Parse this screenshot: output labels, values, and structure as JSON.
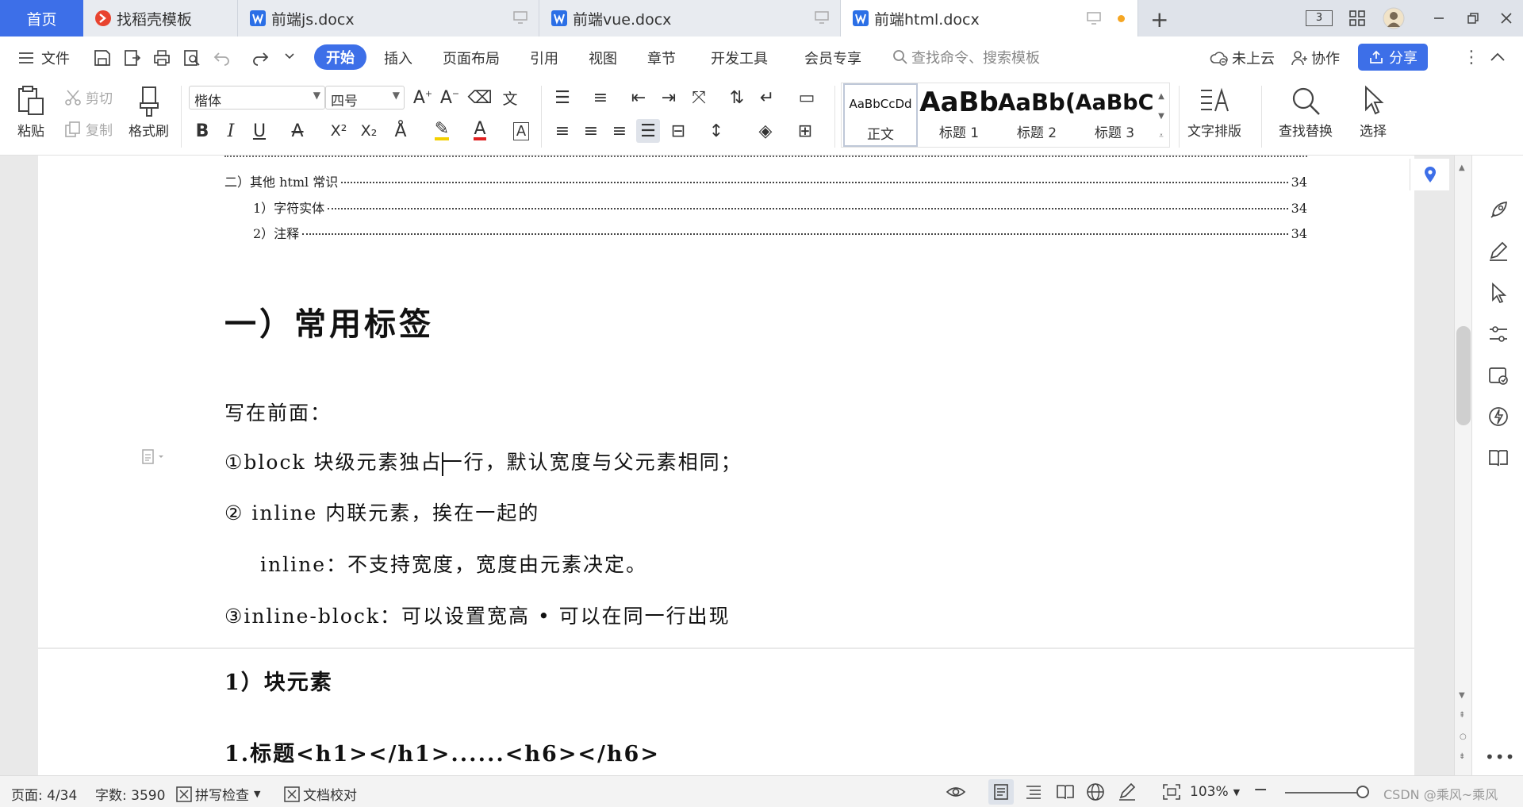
{
  "tabs": {
    "home": "首页",
    "items": [
      {
        "label": "找稻壳模板"
      },
      {
        "label": "前端js.docx"
      },
      {
        "label": "前端vue.docx"
      },
      {
        "label": "前端html.docx"
      }
    ],
    "layout_label": "3"
  },
  "menu": {
    "file": "文件",
    "items": [
      "开始",
      "插入",
      "页面布局",
      "引用",
      "视图",
      "章节",
      "开发工具",
      "会员专享"
    ],
    "search_placeholder": "查找命令、搜索模板",
    "cloud": "未上云",
    "collab": "协作",
    "share": "分享"
  },
  "ribbon": {
    "paste": "粘贴",
    "cut": "剪切",
    "copy": "复制",
    "format_painter": "格式刷",
    "font_name": "楷体",
    "font_size": "四号",
    "styles": [
      {
        "sample": "AaBbCcDd",
        "name": "正文"
      },
      {
        "sample": "AaBb",
        "name": "标题 1"
      },
      {
        "sample": "AaBb(",
        "name": "标题 2"
      },
      {
        "sample": "AaBbC",
        "name": "标题 3"
      }
    ],
    "text_layout": "文字排版",
    "find_replace": "查找替换",
    "select": "选择"
  },
  "document": {
    "toc": [
      {
        "text": "二）其他 html 常识",
        "page": "34"
      },
      {
        "text": "1）字符实体",
        "page": "34"
      },
      {
        "text": "2）注释",
        "page": "34"
      }
    ],
    "heading1": "一）常用标签",
    "intro": "写在前面：",
    "p1_before_caret": "①block 块级元素独占",
    "p1_after_caret": "一行，默认宽度与父元素相同；",
    "p2": "② inline 内联元素，挨在一起的",
    "p3": "inline：不支持宽度，宽度由元素决定。",
    "p4": "③inline-block：可以设置宽高 • 可以在同一行出现",
    "heading2": "1）块元素",
    "heading3": "1.标题<h1></h1>......<h6></h6>"
  },
  "status": {
    "page": "页面: 4/34",
    "words": "字数: 3590",
    "spell": "拼写检查",
    "proof": "文档校对",
    "zoom": "103%",
    "watermark": "CSDN @乘风~乘风"
  },
  "colors": {
    "accent": "#3d6fe8",
    "unsaved_dot": "#f5a623"
  }
}
